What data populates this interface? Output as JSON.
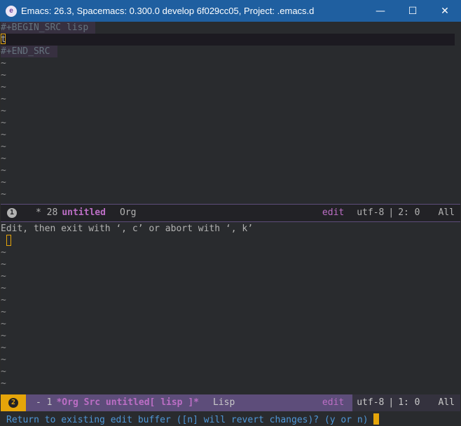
{
  "window": {
    "title": "Emacs: 26.3, Spacemacs: 0.300.0 develop 6f029cc05, Project: .emacs.d",
    "minimize": "—",
    "maximize": "☐",
    "close": "✕"
  },
  "top_buffer": {
    "begin_src": "#+BEGIN_SRC lisp",
    "current_line": "t",
    "end_src": "#+END_SRC",
    "empty_line_marker": "~"
  },
  "modeline_top": {
    "window_number": "1",
    "state": "* 28",
    "buffer_name": "untitled",
    "major_mode": "Org",
    "minor_mode": "edit",
    "encoding": "utf-8",
    "separator": "|",
    "position": "2: 0",
    "scroll": "All"
  },
  "echo_area": {
    "text": "Edit, then exit with ‘, c’ or abort with ‘, k’"
  },
  "bottom_buffer": {
    "empty_line_marker": "~"
  },
  "modeline_bottom": {
    "window_number": "2",
    "state": "- 1",
    "buffer_name": "*Org Src untitled[ lisp ]*",
    "major_mode": "Lisp",
    "minor_mode": "edit",
    "encoding": "utf-8",
    "separator": "|",
    "position": "1: 0",
    "scroll": "All"
  },
  "minibuffer": {
    "prompt": "Return to existing edit buffer ([n] will revert changes)? (y or n) "
  },
  "colors": {
    "titlebar": "#1f5fa0",
    "background": "#292b2e",
    "cursor": "#e5a50a",
    "accent": "#bc6ec5",
    "minibuffer_text": "#4f97d7",
    "modeline_active": "#5d4d7a"
  }
}
